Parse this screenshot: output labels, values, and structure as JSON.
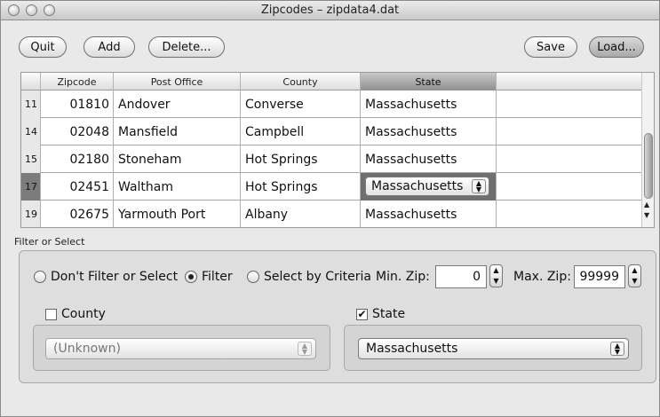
{
  "window": {
    "title": "Zipcodes – zipdata4.dat"
  },
  "toolbar": {
    "quit": "Quit",
    "add": "Add",
    "delete": "Delete...",
    "save": "Save",
    "load": "Load..."
  },
  "table": {
    "columns": [
      "Zipcode",
      "Post Office",
      "County",
      "State"
    ],
    "rows": [
      {
        "n": "11",
        "zip": "01810",
        "po": "Andover",
        "county": "Converse",
        "state": "Massachusetts"
      },
      {
        "n": "14",
        "zip": "02048",
        "po": "Mansfield",
        "county": "Campbell",
        "state": "Massachusetts"
      },
      {
        "n": "15",
        "zip": "02180",
        "po": "Stoneham",
        "county": "Hot Springs",
        "state": "Massachusetts"
      },
      {
        "n": "17",
        "zip": "02451",
        "po": "Waltham",
        "county": "Hot Springs",
        "state": "Massachusetts"
      },
      {
        "n": "19",
        "zip": "02675",
        "po": "Yarmouth Port",
        "county": "Albany",
        "state": "Massachusetts"
      }
    ]
  },
  "filter": {
    "section_label": "Filter or Select",
    "opt_none": "Don't Filter or Select",
    "opt_filter": "Filter",
    "opt_criteria": "Select by Criteria",
    "min_label": "Min. Zip:",
    "min_value": "0",
    "max_label": "Max. Zip:",
    "max_value": "99999",
    "county_label": "County",
    "county_checked": false,
    "county_value": "(Unknown)",
    "state_label": "State",
    "state_checked": true,
    "state_value": "Massachusetts"
  }
}
